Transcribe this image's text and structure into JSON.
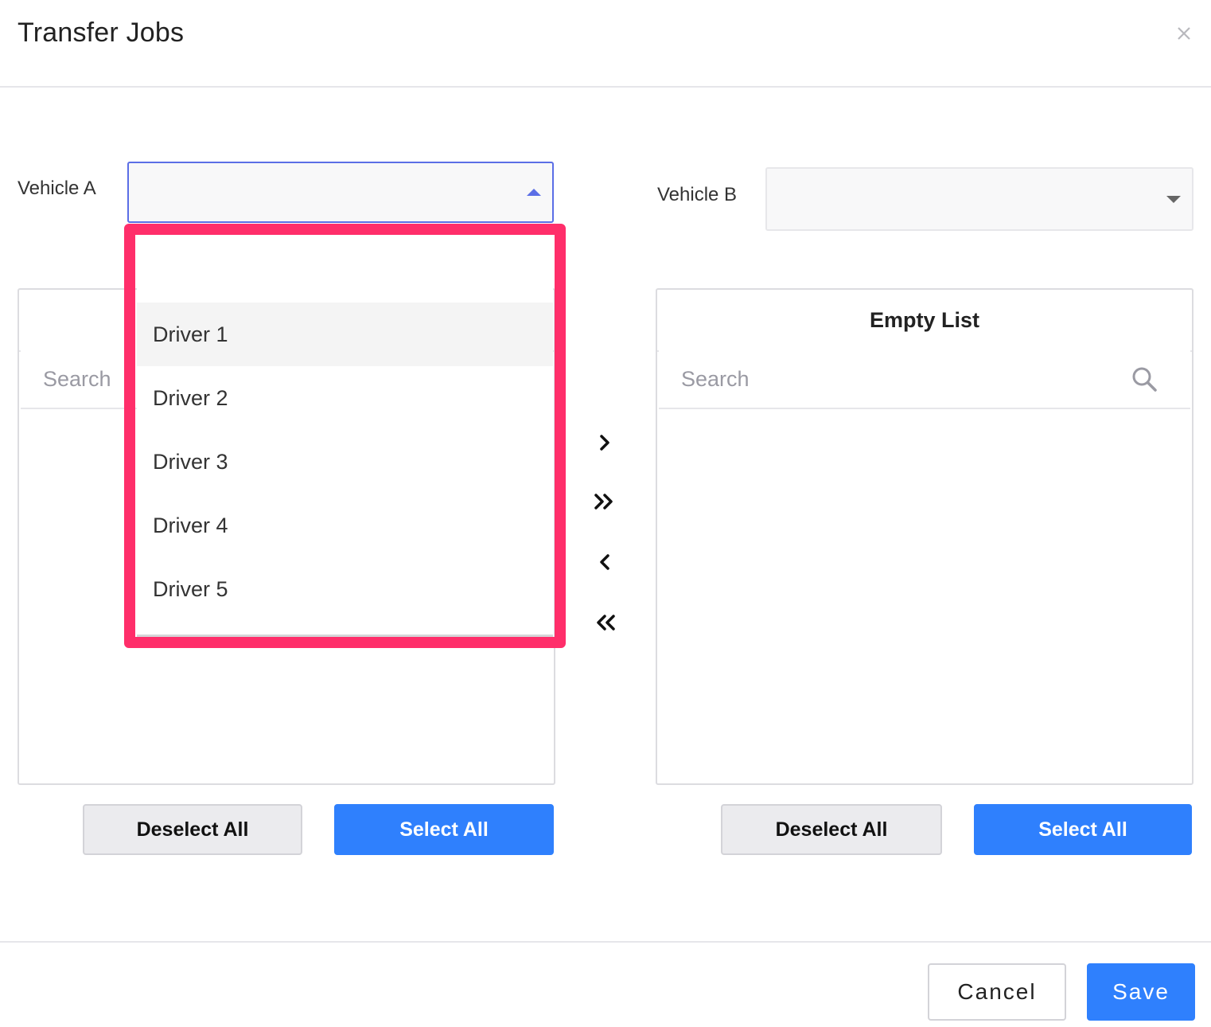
{
  "dialog": {
    "title": "Transfer Jobs",
    "close_symbol": "×"
  },
  "vehicle_a": {
    "label": "Vehicle A",
    "value": "",
    "dropdown_open": true
  },
  "vehicle_b": {
    "label": "Vehicle B",
    "value": ""
  },
  "dropdown": {
    "blank_option": "",
    "options": [
      "Driver 1",
      "Driver 2",
      "Driver 3",
      "Driver 4",
      "Driver 5"
    ],
    "highlighted_option": "Driver 1"
  },
  "left_list": {
    "header": "",
    "search_placeholder": "Search",
    "deselect_label": "Deselect All",
    "select_label": "Select All"
  },
  "right_list": {
    "header": "Empty List",
    "search_placeholder": "Search",
    "deselect_label": "Deselect All",
    "select_label": "Select All"
  },
  "transfer_controls": {
    "move_right": "›",
    "move_all_right": "»",
    "move_left": "‹",
    "move_all_left": "«"
  },
  "footer": {
    "cancel_label": "Cancel",
    "save_label": "Save"
  },
  "colors": {
    "primary": "#2f80fd",
    "focus_border": "#5b6ee6",
    "highlight_box": "#ff2e6a"
  }
}
